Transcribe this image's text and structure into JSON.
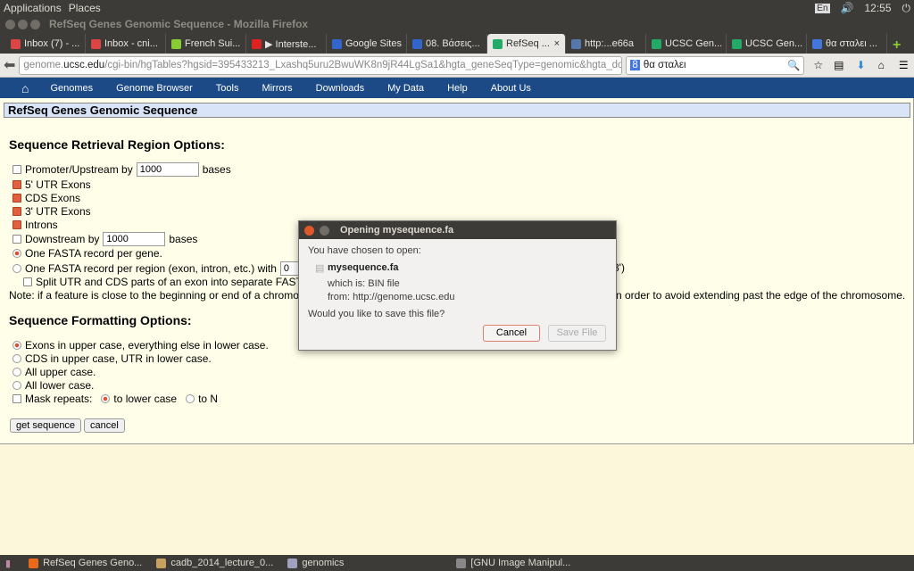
{
  "panel": {
    "applications": "Applications",
    "places": "Places",
    "lang": "En",
    "time": "12:55"
  },
  "window": {
    "title": "RefSeq Genes Genomic Sequence - Mozilla Firefox"
  },
  "tabs": [
    {
      "label": "Inbox (7) - ...",
      "color": "#d44"
    },
    {
      "label": "Inbox - cni...",
      "color": "#d44"
    },
    {
      "label": "French Sui...",
      "color": "#8c3"
    },
    {
      "label": "▶ Interste...",
      "color": "#d22"
    },
    {
      "label": "Google Sites",
      "color": "#36c"
    },
    {
      "label": "08. Βάσεις...",
      "color": "#36c"
    },
    {
      "label": "RefSeq ...",
      "color": "#2a6",
      "active": true
    },
    {
      "label": "http:...e66a",
      "color": "#57a"
    },
    {
      "label": "UCSC Gen...",
      "color": "#2a6"
    },
    {
      "label": "UCSC Gen...",
      "color": "#2a6"
    },
    {
      "label": "θα σταλει ...",
      "color": "#47d"
    }
  ],
  "nav": {
    "url_host": "genome.",
    "url_domain": "ucsc.edu",
    "url_path": "/cgi-bin/hgTables?hgsid=395433213_Lxashq5uru2BwuWK8n9jR44LgSa1&hgta_geneSeqType=genomic&hgta_doC",
    "search": "θα σταλει"
  },
  "menu": [
    "Genomes",
    "Genome Browser",
    "Tools",
    "Mirrors",
    "Downloads",
    "My Data",
    "Help",
    "About Us"
  ],
  "page": {
    "header": "RefSeq Genes Genomic Sequence",
    "region_title": "Sequence Retrieval Region Options:",
    "promoter": "Promoter/Upstream by",
    "promoter_val": "1000",
    "bases": "bases",
    "utr5": "5' UTR Exons",
    "cds": "CDS Exons",
    "utr3": "3' UTR Exons",
    "introns": "Introns",
    "downstream": "Downstream by",
    "downstream_val": "1000",
    "one_per_gene": "One FASTA record per gene.",
    "one_per_region": "One FASTA record per region (exon, intron, etc.) with",
    "region_val": "0",
    "region_tail": "3')",
    "split": "Split UTR and CDS parts of an exon into separate FASTA r",
    "note": "Note: if a feature is close to the beginning or end of a chromosom",
    "note_tail": "n order to avoid extending past the edge of the chromosome.",
    "format_title": "Sequence Formatting Options:",
    "f1": "Exons in upper case, everything else in lower case.",
    "f2": "CDS in upper case, UTR in lower case.",
    "f3": "All upper case.",
    "f4": "All lower case.",
    "mask": "Mask repeats:",
    "mask_lower": "to lower case",
    "mask_n": "to N",
    "get": "get sequence",
    "cancel": "cancel"
  },
  "dialog": {
    "title": "Opening mysequence.fa",
    "chosen": "You have chosen to open:",
    "file": "mysequence.fa",
    "which": "which is:  BIN file",
    "from": "from:  http://genome.ucsc.edu",
    "question": "Would you like to save this file?",
    "cancel": "Cancel",
    "save": "Save File"
  },
  "taskbar": [
    "RefSeq Genes Geno...",
    "cadb_2014_lecture_0...",
    "genomics",
    "[GNU Image Manipul..."
  ]
}
